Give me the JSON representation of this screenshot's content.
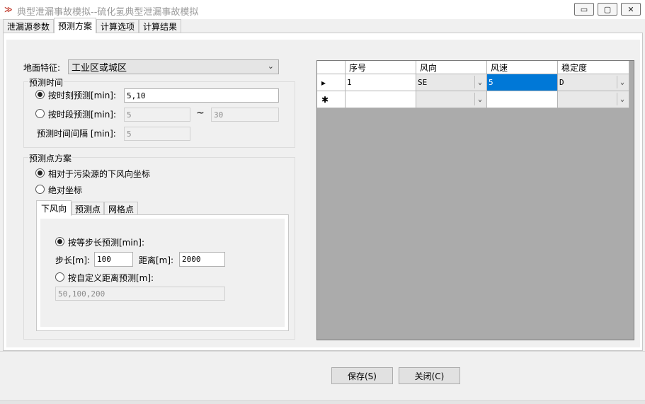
{
  "window": {
    "title": "典型泄漏事故模拟--硫化氢典型泄漏事故模拟",
    "app_icon": "app-logo-icon",
    "minimize": "▭",
    "maximize": "▢",
    "close": "✕"
  },
  "tabs": [
    {
      "label": "泄漏源参数"
    },
    {
      "label": "预测方案"
    },
    {
      "label": "计算选项"
    },
    {
      "label": "计算结果"
    }
  ],
  "terrain": {
    "label": "地面特征:",
    "value": "工业区或城区"
  },
  "predict_time": {
    "group_label": "预测时间",
    "by_moment_label": "按时刻预测[min]:",
    "by_moment_value": "5,10",
    "by_period_label": "按时段预测[min]:",
    "period_start": "5",
    "period_sep": "~",
    "period_end": "30",
    "interval_label": "预测时间间隔 [min]:",
    "interval_value": "5"
  },
  "predict_points": {
    "group_label": "预测点方案",
    "relative_label": "相对于污染源的下风向坐标",
    "absolute_label": "绝对坐标",
    "subtabs": [
      {
        "label": "下风向"
      },
      {
        "label": "预测点"
      },
      {
        "label": "网格点"
      }
    ],
    "equal_step_label": "按等步长预测[min]:",
    "step_label": "步长[m]:",
    "step_value": "100",
    "distance_label": "距离[m]:",
    "distance_value": "2000",
    "custom_label": "按自定义距离预测[m]:",
    "custom_value": "50,100,200"
  },
  "grid": {
    "columns": [
      "序号",
      "风向",
      "风速",
      "稳定度"
    ],
    "rows": [
      {
        "indicator": "▸",
        "cells": [
          "1",
          "SE",
          "5",
          "D"
        ]
      },
      {
        "indicator": "✱",
        "cells": [
          "",
          "",
          "",
          ""
        ]
      }
    ]
  },
  "buttons": {
    "save": "保存(S)",
    "close": "关闭(C)"
  },
  "colors": {
    "selection": "#0078d7",
    "grid_background": "#ababab",
    "title_text": "#9a9a9a"
  }
}
